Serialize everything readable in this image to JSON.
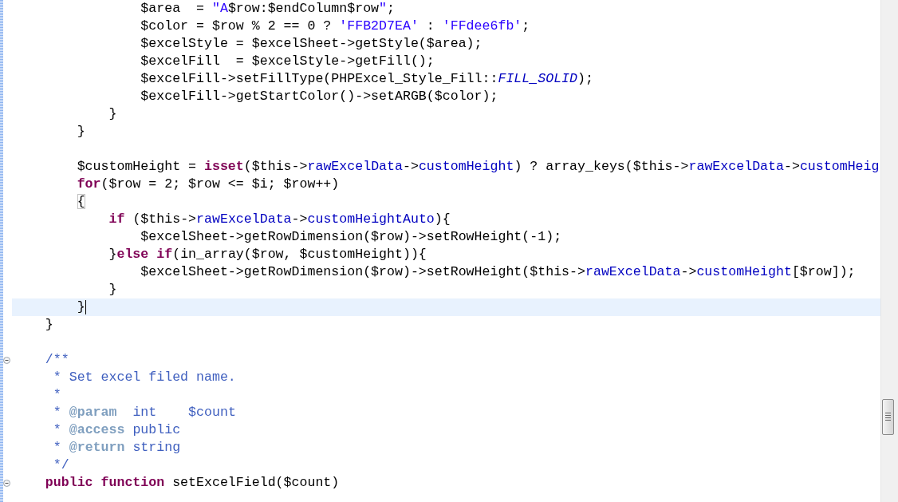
{
  "editor": {
    "lines": [
      {
        "tokens": [
          {
            "text": "                $area  = ",
            "kind": "plain"
          },
          {
            "text": "\"A",
            "kind": "string"
          },
          {
            "text": "$row:$endColumn$row",
            "kind": "plain"
          },
          {
            "text": "\"",
            "kind": "string"
          },
          {
            "text": ";",
            "kind": "plain"
          }
        ]
      },
      {
        "tokens": [
          {
            "text": "                $color = $row % 2 == 0 ? ",
            "kind": "plain"
          },
          {
            "text": "'FFB2D7EA'",
            "kind": "string"
          },
          {
            "text": " : ",
            "kind": "plain"
          },
          {
            "text": "'FFdee6fb'",
            "kind": "string"
          },
          {
            "text": ";",
            "kind": "plain"
          }
        ]
      },
      {
        "tokens": [
          {
            "text": "                $excelStyle = $excelSheet->getStyle($area);",
            "kind": "plain"
          }
        ]
      },
      {
        "tokens": [
          {
            "text": "                $excelFill  = $excelStyle->getFill();",
            "kind": "plain"
          }
        ]
      },
      {
        "tokens": [
          {
            "text": "                $excelFill->setFillType(PHPExcel_Style_Fill::",
            "kind": "plain"
          },
          {
            "text": "FILL_SOLID",
            "kind": "constant"
          },
          {
            "text": ");",
            "kind": "plain"
          }
        ]
      },
      {
        "tokens": [
          {
            "text": "                $excelFill->getStartColor()->setARGB($color);",
            "kind": "plain"
          }
        ]
      },
      {
        "tokens": [
          {
            "text": "            }",
            "kind": "plain"
          }
        ]
      },
      {
        "tokens": [
          {
            "text": "        }",
            "kind": "plain"
          }
        ]
      },
      {
        "blank_line_before": true,
        "tokens": [
          {
            "text": "        $customHeight = ",
            "kind": "plain"
          },
          {
            "text": "isset",
            "kind": "keyword"
          },
          {
            "text": "($this->",
            "kind": "plain"
          },
          {
            "text": "rawExcelData",
            "kind": "property"
          },
          {
            "text": "->",
            "kind": "plain"
          },
          {
            "text": "customHeight",
            "kind": "property"
          },
          {
            "text": ") ? array_keys($this->",
            "kind": "plain"
          },
          {
            "text": "rawExcelData",
            "kind": "property"
          },
          {
            "text": "->",
            "kind": "plain"
          },
          {
            "text": "customHeig",
            "kind": "property"
          }
        ]
      },
      {
        "tokens": [
          {
            "text": "        for",
            "kind": "keyword"
          },
          {
            "text": "($row = 2; $row <= $i; $row++)",
            "kind": "plain"
          }
        ]
      },
      {
        "tokens": [
          {
            "text": "        {",
            "kind": "matched"
          }
        ]
      },
      {
        "tokens": [
          {
            "text": "            if",
            "kind": "keyword"
          },
          {
            "text": " ($this->",
            "kind": "plain"
          },
          {
            "text": "rawExcelData",
            "kind": "property"
          },
          {
            "text": "->",
            "kind": "plain"
          },
          {
            "text": "customHeightAuto",
            "kind": "property"
          },
          {
            "text": "){",
            "kind": "plain"
          }
        ]
      },
      {
        "tokens": [
          {
            "text": "                $excelSheet->getRowDimension($row)->setRowHeight(-1);",
            "kind": "plain"
          }
        ]
      },
      {
        "tokens": [
          {
            "text": "            }",
            "kind": "plain"
          },
          {
            "text": "else if",
            "kind": "keyword"
          },
          {
            "text": "(in_array($row, $customHeight)){",
            "kind": "plain"
          }
        ]
      },
      {
        "tokens": [
          {
            "text": "                $excelSheet->getRowDimension($row)->setRowHeight($this->",
            "kind": "plain"
          },
          {
            "text": "rawExcelData",
            "kind": "property"
          },
          {
            "text": "->",
            "kind": "plain"
          },
          {
            "text": "customHeight",
            "kind": "property"
          },
          {
            "text": "[$row]);",
            "kind": "plain"
          }
        ]
      },
      {
        "tokens": [
          {
            "text": "            }",
            "kind": "plain"
          }
        ]
      },
      {
        "tokens": [
          {
            "text": "        }",
            "kind": "plain"
          }
        ],
        "current": true
      },
      {
        "tokens": [
          {
            "text": "    }",
            "kind": "plain"
          }
        ]
      },
      {
        "blank_line_before": true,
        "tokens": [
          {
            "text": "    /**",
            "kind": "doc"
          }
        ],
        "foldable": true
      },
      {
        "tokens": [
          {
            "text": "     * Set excel filed name.",
            "kind": "doc"
          }
        ]
      },
      {
        "tokens": [
          {
            "text": "     *",
            "kind": "doc"
          }
        ]
      },
      {
        "tokens": [
          {
            "text": "     * ",
            "kind": "doc"
          },
          {
            "text": "@param",
            "kind": "doctag"
          },
          {
            "text": "  int    $count",
            "kind": "doc"
          }
        ]
      },
      {
        "tokens": [
          {
            "text": "     * ",
            "kind": "doc"
          },
          {
            "text": "@access",
            "kind": "doctag"
          },
          {
            "text": " public",
            "kind": "doc"
          }
        ]
      },
      {
        "tokens": [
          {
            "text": "     * ",
            "kind": "doc"
          },
          {
            "text": "@return",
            "kind": "doctag"
          },
          {
            "text": " string",
            "kind": "doc"
          }
        ]
      },
      {
        "tokens": [
          {
            "text": "     */",
            "kind": "doc"
          }
        ]
      },
      {
        "tokens": [
          {
            "text": "    public function",
            "kind": "keyword"
          },
          {
            "text": " setExcelField($count)",
            "kind": "plain"
          }
        ],
        "foldable": true
      }
    ]
  }
}
